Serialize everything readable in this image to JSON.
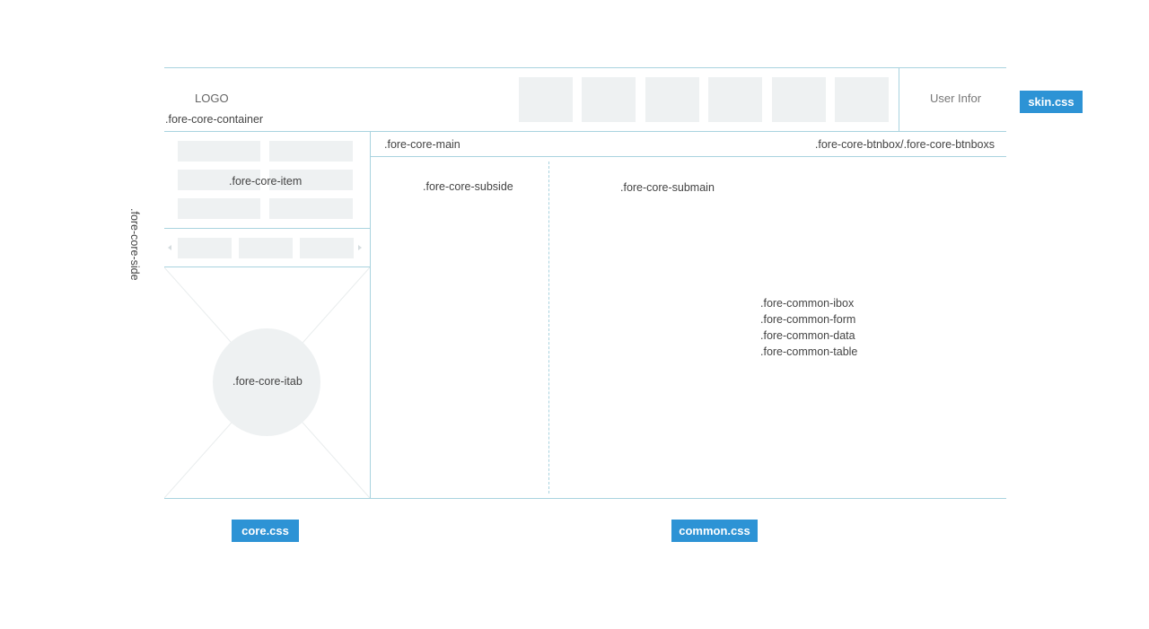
{
  "header": {
    "logo": "LOGO",
    "container_label": ".fore-core-container",
    "user_info": "User Infor",
    "nav_box_count": 6
  },
  "side": {
    "label": ".fore-core-side",
    "item_label": ".fore-core-item",
    "itab_label": ".fore-core-itab"
  },
  "main": {
    "label": ".fore-core-main",
    "btnbox_label": ".fore-core-btnbox/.fore-core-btnboxs",
    "subside_label": ".fore-core-subside",
    "submain_label": ".fore-core-submain",
    "common_modules": [
      ".fore-common-ibox",
      ".fore-common-form",
      ".fore-common-data",
      ".fore-common-table"
    ]
  },
  "tags": {
    "skin": "skin.css",
    "core": "core.css",
    "common": "common.css"
  },
  "colors": {
    "line": "#a9d3df",
    "placeholder": "#eef1f2",
    "tag": "#2d93d5"
  }
}
